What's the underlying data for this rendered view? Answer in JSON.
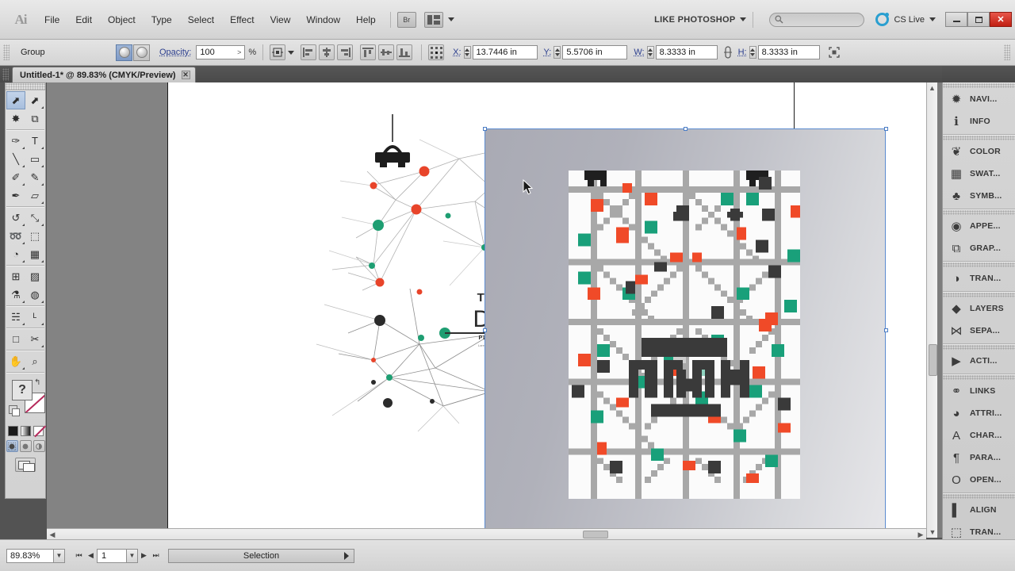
{
  "app": {
    "name": "Adobe Illustrator",
    "logo_text": "Ai"
  },
  "menubar": {
    "items": [
      {
        "label": "File"
      },
      {
        "label": "Edit"
      },
      {
        "label": "Object"
      },
      {
        "label": "Type"
      },
      {
        "label": "Select"
      },
      {
        "label": "Effect"
      },
      {
        "label": "View"
      },
      {
        "label": "Window"
      },
      {
        "label": "Help"
      }
    ],
    "bridge_button": "Br",
    "workspace": "LIKE PHOTOSHOP",
    "search_placeholder": "",
    "cslive": "CS Live",
    "window_buttons": {
      "minimize": "",
      "maximize": "",
      "close": "✕"
    }
  },
  "controlbar": {
    "selection_type": "Group",
    "opacity_label": "Opacity:",
    "opacity_value": "100",
    "percent": "%",
    "x_label": "X:",
    "x_value": "13.7446 in",
    "y_label": "Y:",
    "y_value": "5.5706 in",
    "w_label": "W:",
    "w_value": "8.3333 in",
    "h_label": "H:",
    "h_value": "8.3333 in"
  },
  "document": {
    "tab_title": "Untitled-1* @ 89.83% (CMYK/Preview)",
    "tab_close": "✕"
  },
  "tools": {
    "items": [
      {
        "name": "selection-tool",
        "glyph": "⬈",
        "selected": true,
        "sub": false
      },
      {
        "name": "direct-selection-tool",
        "glyph": "⬈",
        "selected": false,
        "sub": true
      },
      {
        "name": "magic-wand-tool",
        "glyph": "✸",
        "selected": false,
        "sub": false
      },
      {
        "name": "lasso-tool",
        "glyph": "⧉",
        "selected": false,
        "sub": false
      },
      {
        "name": "pen-tool",
        "glyph": "✑",
        "selected": false,
        "sub": true
      },
      {
        "name": "type-tool",
        "glyph": "T",
        "selected": false,
        "sub": true
      },
      {
        "name": "line-segment-tool",
        "glyph": "╲",
        "selected": false,
        "sub": true
      },
      {
        "name": "rectangle-tool",
        "glyph": "▭",
        "selected": false,
        "sub": true
      },
      {
        "name": "paintbrush-tool",
        "glyph": "✐",
        "selected": false,
        "sub": true
      },
      {
        "name": "pencil-tool",
        "glyph": "✎",
        "selected": false,
        "sub": true
      },
      {
        "name": "blob-brush-tool",
        "glyph": "✒",
        "selected": false,
        "sub": false
      },
      {
        "name": "eraser-tool",
        "glyph": "▱",
        "selected": false,
        "sub": true
      },
      {
        "name": "rotate-tool",
        "glyph": "↺",
        "selected": false,
        "sub": true
      },
      {
        "name": "scale-tool",
        "glyph": "⤡",
        "selected": false,
        "sub": true
      },
      {
        "name": "width-tool",
        "glyph": "➿",
        "selected": false,
        "sub": true
      },
      {
        "name": "free-transform-tool",
        "glyph": "⬚",
        "selected": false,
        "sub": false
      },
      {
        "name": "shape-builder-tool",
        "glyph": "◔",
        "selected": false,
        "sub": true
      },
      {
        "name": "perspective-grid-tool",
        "glyph": "▦",
        "selected": false,
        "sub": true
      },
      {
        "name": "mesh-tool",
        "glyph": "⊞",
        "selected": false,
        "sub": false
      },
      {
        "name": "gradient-tool",
        "glyph": "▨",
        "selected": false,
        "sub": false
      },
      {
        "name": "eyedropper-tool",
        "glyph": "⚗",
        "selected": false,
        "sub": true
      },
      {
        "name": "blend-tool",
        "glyph": "◍",
        "selected": false,
        "sub": true
      },
      {
        "name": "symbol-sprayer-tool",
        "glyph": "☵",
        "selected": false,
        "sub": true
      },
      {
        "name": "column-graph-tool",
        "glyph": "ᴸ",
        "selected": false,
        "sub": true
      },
      {
        "name": "artboard-tool",
        "glyph": "□",
        "selected": false,
        "sub": false
      },
      {
        "name": "slice-tool",
        "glyph": "✂",
        "selected": false,
        "sub": true
      },
      {
        "name": "hand-tool",
        "glyph": "✋",
        "selected": false,
        "sub": true
      },
      {
        "name": "zoom-tool",
        "glyph": "⌕",
        "selected": false,
        "sub": false
      }
    ],
    "fill_label": "?",
    "swap_glyph": "↰",
    "color_modes": [
      "color-fill",
      "gradient-fill",
      "none-fill"
    ],
    "draw_modes": [
      "draw-normal",
      "draw-behind",
      "draw-inside"
    ],
    "screen_mode": "change-screen-mode"
  },
  "dock": {
    "groups": [
      {
        "items": [
          {
            "label": "NAVI...",
            "icon": "navigator-icon",
            "glyph": "✹"
          },
          {
            "label": "INFO",
            "icon": "info-icon",
            "glyph": "ℹ"
          }
        ]
      },
      {
        "items": [
          {
            "label": "COLOR",
            "icon": "color-palette-icon",
            "glyph": "❦"
          },
          {
            "label": "SWAT...",
            "icon": "swatches-icon",
            "glyph": "▦"
          },
          {
            "label": "SYMB...",
            "icon": "symbols-icon",
            "glyph": "♣"
          }
        ]
      },
      {
        "items": [
          {
            "label": "APPE...",
            "icon": "appearance-icon",
            "glyph": "◉"
          },
          {
            "label": "GRAP...",
            "icon": "graphic-styles-icon",
            "glyph": "⧉"
          }
        ]
      },
      {
        "items": [
          {
            "label": "TRAN...",
            "icon": "transparency-icon",
            "glyph": "◑"
          }
        ]
      },
      {
        "items": [
          {
            "label": "LAYERS",
            "icon": "layers-icon",
            "glyph": "◆"
          },
          {
            "label": "SEPA...",
            "icon": "separations-preview-icon",
            "glyph": "⋈"
          }
        ]
      },
      {
        "items": [
          {
            "label": "ACTI...",
            "icon": "actions-icon",
            "glyph": "▶"
          }
        ]
      },
      {
        "items": [
          {
            "label": "LINKS",
            "icon": "links-icon",
            "glyph": "⚭"
          },
          {
            "label": "ATTRI...",
            "icon": "attributes-icon",
            "glyph": "◕"
          },
          {
            "label": "CHAR...",
            "icon": "character-icon",
            "glyph": "A"
          },
          {
            "label": "PARA...",
            "icon": "paragraph-icon",
            "glyph": "¶"
          },
          {
            "label": "OPEN...",
            "icon": "opentype-icon",
            "glyph": "O"
          }
        ]
      },
      {
        "items": [
          {
            "label": "ALIGN",
            "icon": "align-icon",
            "glyph": "▌"
          },
          {
            "label": "TRAN...",
            "icon": "transform-icon",
            "glyph": "⬚"
          }
        ]
      }
    ]
  },
  "statusbar": {
    "zoom_level": "89.83%",
    "page_number": "1",
    "status_text": "Selection",
    "first_glyph": "⏮",
    "prev_glyph": "◀",
    "next_glyph": "▶",
    "last_glyph": "⏭"
  },
  "artwork": {
    "poster_title_small": "TECHNOLOGY",
    "poster_title_large": "DESIGN",
    "poster_sub": "PLACE YOUR TEXT HERE",
    "poster_body": "Lorem ipsum dolor sit amet consectetur adipiscing elit sed do",
    "colors": {
      "node_red": "#e8442a",
      "node_green": "#1e9e72",
      "node_dark": "#2b2b2b",
      "line_gray": "#9a9a9a",
      "selection_blue": "#5b8bd0",
      "accent_blue": "#2a9fd0",
      "close_red": "#c01f12"
    }
  }
}
